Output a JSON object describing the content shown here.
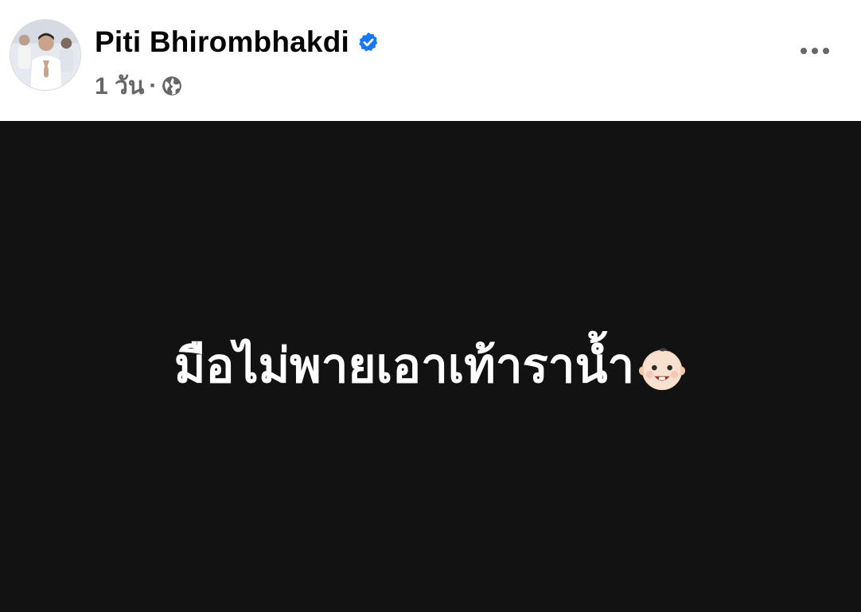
{
  "post": {
    "author_name": "Piti Bhirombhakdi",
    "verified": true,
    "timestamp": "1 วัน",
    "separator": "·",
    "audience_icon": "globe-icon",
    "menu_icon": "more-horizontal-icon",
    "status_text": "มือไม่พายเอาเท้าราน้ำ",
    "status_emoji": "baby-face-icon"
  },
  "colors": {
    "status_background": "#121212",
    "verified_badge": "#1877f2",
    "meta_text": "#65676b"
  }
}
